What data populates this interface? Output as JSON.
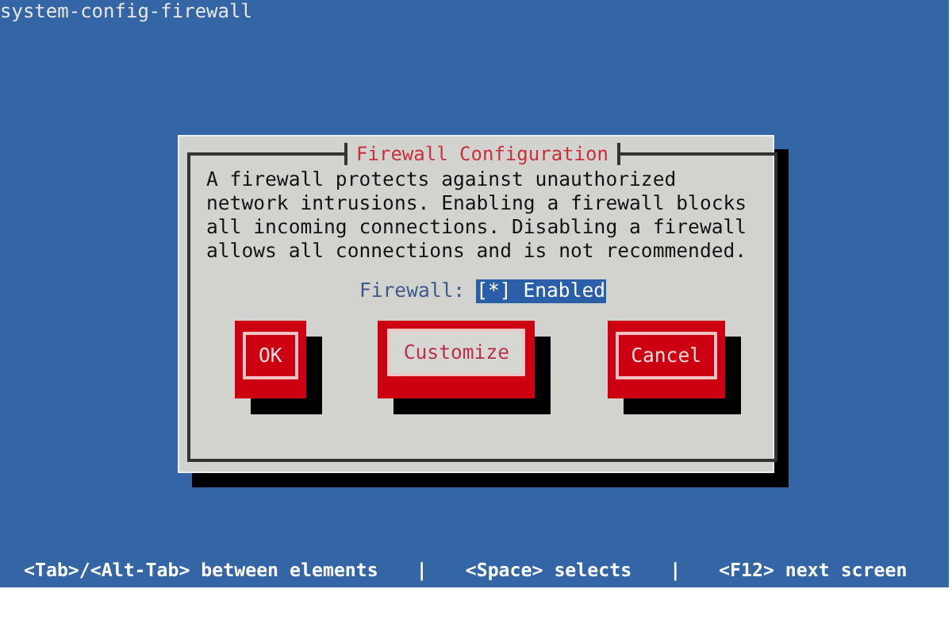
{
  "screen": {
    "title": "system-config-firewall"
  },
  "dialog": {
    "title": "Firewall Configuration",
    "message": "A firewall protects against unauthorized network intrusions. Enabling a firewall blocks all incoming connections. Disabling a firewall allows all connections and is not recommended.",
    "field": {
      "label": "Firewall:",
      "value": "[*] Enabled",
      "selected": true
    },
    "buttons": [
      {
        "label": "OK",
        "selected": false
      },
      {
        "label": "Customize",
        "selected": true
      },
      {
        "label": "Cancel",
        "selected": false
      }
    ]
  },
  "status_bar": [
    "<Tab>/<Alt-Tab> between elements",
    "|",
    "<Space> selects",
    "|",
    "<F12> next screen"
  ]
}
